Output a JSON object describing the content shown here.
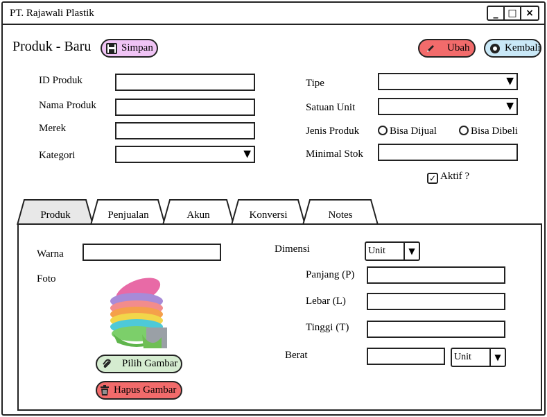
{
  "window": {
    "title": "PT. Rajawali Plastik",
    "controls": [
      "_",
      "□",
      "×"
    ]
  },
  "header": {
    "title": "Produk - Baru",
    "save_label": "Simpan",
    "edit_label": "Ubah",
    "back_label": "Kembali"
  },
  "form": {
    "id_label": "ID Produk",
    "name_label": "Nama Produk",
    "brand_label": "Merek",
    "category_label": "Kategori",
    "type_label": "Tipe",
    "unit_label": "Satuan Unit",
    "kind_label": "Jenis Produk",
    "kind_option_sell": "Bisa Dijual",
    "kind_option_buy": "Bisa Dibeli",
    "min_stock_label": "Minimal Stok",
    "active_label": "Aktif ?",
    "active_checked": true
  },
  "tabs": [
    "Produk",
    "Penjualan",
    "Akun",
    "Konversi",
    "Notes"
  ],
  "active_tab": "Produk",
  "produk_tab": {
    "color_label": "Warna",
    "photo_label": "Foto",
    "pick_image_label": "Pilih Gambar",
    "delete_image_label": "Hapus Gambar",
    "dimension_label": "Dimensi",
    "dimension_unit": "Unit",
    "length_label": "Panjang (P)",
    "width_label": "Lebar (L)",
    "height_label": "Tinggi (T)",
    "weight_label": "Berat",
    "weight_unit": "Unit"
  },
  "colors": {
    "save_btn": "#f0c4f5",
    "edit_btn": "#f26b6b",
    "back_btn": "#c9e8f7",
    "pick_btn": "#d5ecd0",
    "delete_btn": "#f26b6b"
  },
  "icons": {
    "save": "floppy-disk-icon",
    "edit": "pencil-icon",
    "back": "back-circle-icon",
    "pick": "paperclip-icon",
    "delete": "trash-icon"
  }
}
